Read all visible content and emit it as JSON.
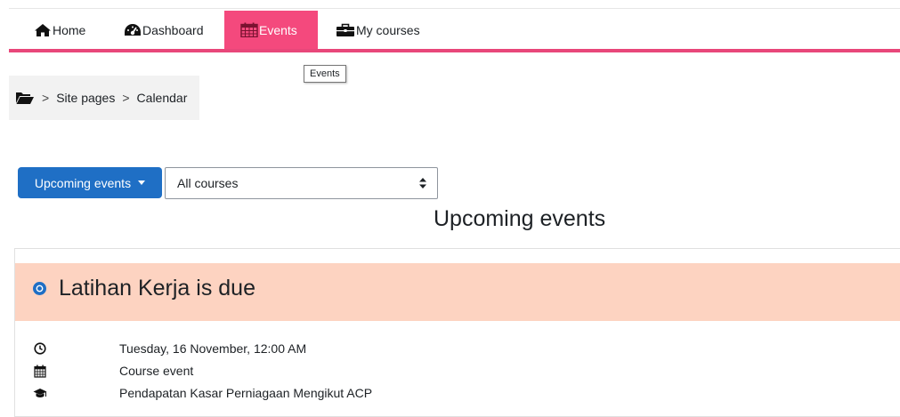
{
  "nav": {
    "items": [
      {
        "label": "Home",
        "icon": "home-icon"
      },
      {
        "label": "Dashboard",
        "icon": "dashboard-icon"
      },
      {
        "label": "Events",
        "icon": "calendar-icon",
        "active": true
      },
      {
        "label": "My courses",
        "icon": "briefcase-icon"
      }
    ],
    "accent_color": "#e8477a"
  },
  "tooltip": {
    "text": "Events"
  },
  "breadcrumb": {
    "icon": "folder-open-icon",
    "items": [
      "Site pages",
      "Calendar"
    ],
    "separator": ">"
  },
  "controls": {
    "view_button_label": "Upcoming events",
    "course_select_value": "All courses"
  },
  "main": {
    "heading": "Upcoming events"
  },
  "event": {
    "title": "Latihan Kerja is due",
    "header_color": "#fdd3c1",
    "date": "Tuesday, 16 November, 12:00 AM",
    "type": "Course event",
    "course": "Pendapatan Kasar Perniagaan Mengikut ACP"
  }
}
